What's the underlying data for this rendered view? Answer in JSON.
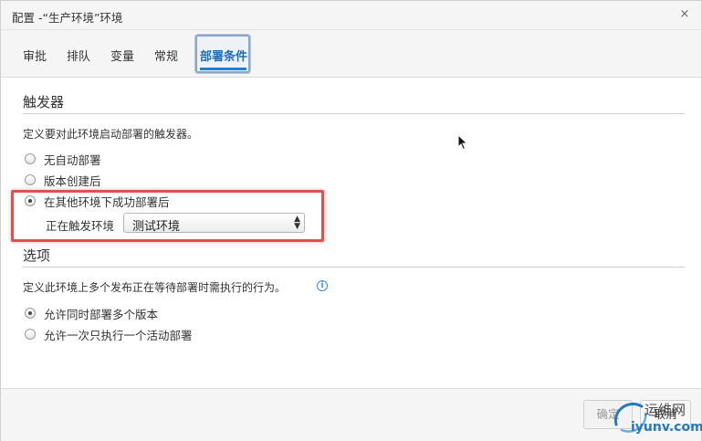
{
  "dialog": {
    "title": "配置 -“生产环境”环境",
    "close_glyph": "×"
  },
  "tabs": [
    {
      "label": "审批",
      "active": false
    },
    {
      "label": "排队",
      "active": false
    },
    {
      "label": "变量",
      "active": false
    },
    {
      "label": "常规",
      "active": false
    },
    {
      "label": "部署条件",
      "active": true
    }
  ],
  "trigger_section": {
    "title": "触发器",
    "description": "定义要对此环境启动部署的触发器。",
    "options": [
      {
        "label": "无自动部署",
        "checked": false
      },
      {
        "label": "版本创建后",
        "checked": false
      },
      {
        "label": "在其他环境下成功部署后",
        "checked": true
      }
    ],
    "env_label": "正在触发环境",
    "env_select_value": "测试环境"
  },
  "options_section": {
    "title": "选项",
    "description": "定义此环境上多个发布正在等待部署时需执行的行为。",
    "info_glyph": "i",
    "options": [
      {
        "label": "允许同时部署多个版本",
        "checked": true
      },
      {
        "label": "允许一次只执行一个活动部署",
        "checked": false
      }
    ]
  },
  "footer": {
    "ok_label": "确定",
    "cancel_label": "取消"
  },
  "watermark": {
    "line1": "运维网",
    "line2": "iyunv.com"
  },
  "colors": {
    "accent": "#1f7fd1",
    "highlight": "#d9534f"
  }
}
